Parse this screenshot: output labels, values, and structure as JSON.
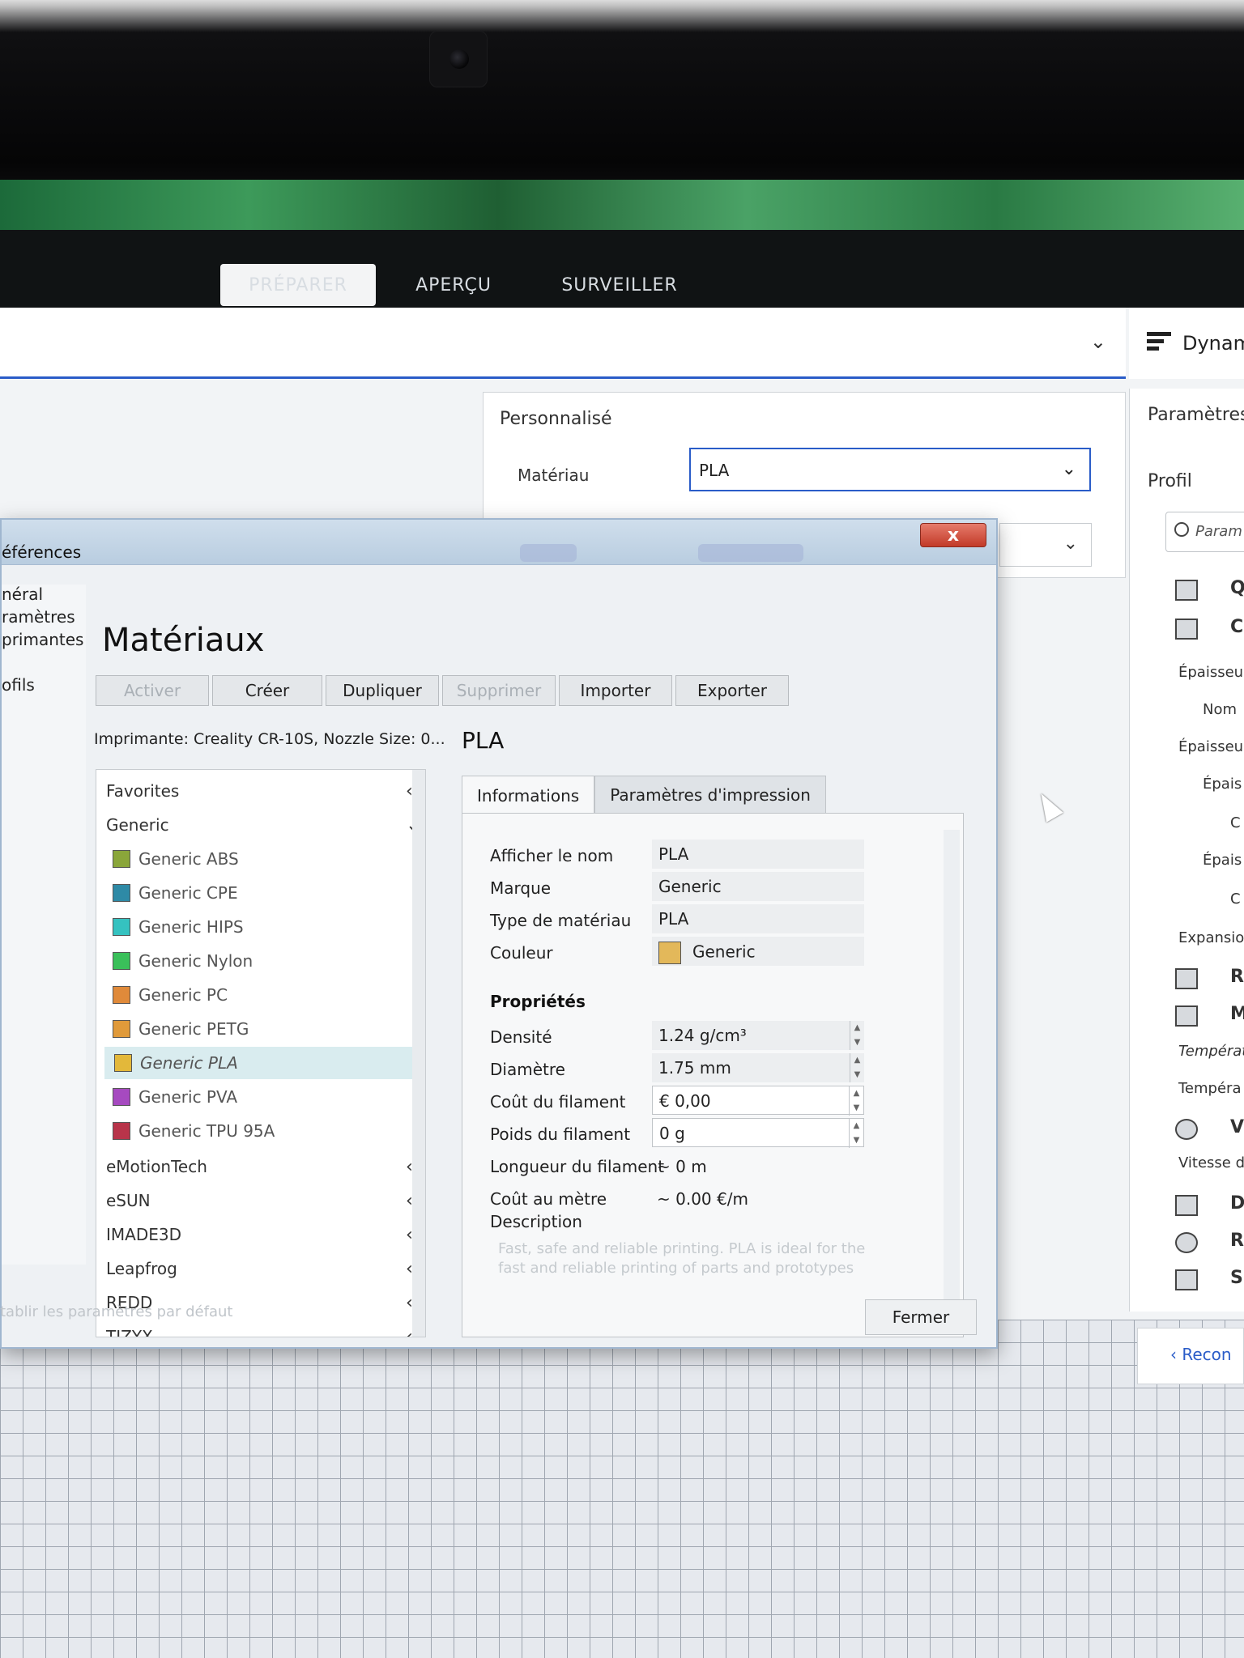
{
  "tabs": {
    "preparer": "PRÉPARER",
    "apercu": "APERÇU",
    "surveiller": "SURVEILLER"
  },
  "right_top": {
    "label": "Dynam"
  },
  "custom_panel": {
    "title": "Personnalisé",
    "material_label": "Matériau",
    "material_value": "PLA"
  },
  "right_panel": {
    "param_title": "Paramètres",
    "profil": "Profil",
    "search_placeholder": "Param",
    "rows": [
      "Q",
      "C",
      "Épaisseu",
      "Nom",
      "Épaisseu",
      "Épais",
      "C",
      "Épais",
      "C",
      "Expansio",
      "R",
      "M",
      "Températ",
      "Tempéra",
      "Vi",
      "Vitesse d",
      "D",
      "R",
      "Su"
    ],
    "recon": "Recon"
  },
  "dialog": {
    "title": "éférences",
    "close_label": "x",
    "nav": [
      "néral",
      "ramètres",
      "primantes",
      "ofils"
    ],
    "heading": "Matériaux",
    "toolbar": {
      "activer": "Activer",
      "creer": "Créer",
      "dupliquer": "Dupliquer",
      "supprimer": "Supprimer",
      "importer": "Importer",
      "exporter": "Exporter"
    },
    "printer": "Imprimante: Creality CR-10S, Nozzle Size: 0...",
    "material_title": "PLA",
    "list": {
      "favorites": "Favorites",
      "generic": "Generic",
      "items": [
        {
          "name": "Generic ABS",
          "color": "#8aa63a"
        },
        {
          "name": "Generic CPE",
          "color": "#2e8aa6"
        },
        {
          "name": "Generic HIPS",
          "color": "#35c2c0"
        },
        {
          "name": "Generic Nylon",
          "color": "#3ac05a"
        },
        {
          "name": "Generic PC",
          "color": "#e08a3a"
        },
        {
          "name": "Generic PETG",
          "color": "#e09a3a"
        },
        {
          "name": "Generic PLA",
          "color": "#e3b83a"
        },
        {
          "name": "Generic PVA",
          "color": "#a64ac0"
        },
        {
          "name": "Generic TPU 95A",
          "color": "#b8344a"
        }
      ],
      "brands": [
        "eMotionTech",
        "eSUN",
        "IMADE3D",
        "Leapfrog",
        "REDD",
        "TIZYX"
      ]
    },
    "tabs": {
      "informations": "Informations",
      "params": "Paramètres d'impression"
    },
    "info": {
      "display_name_label": "Afficher le nom",
      "display_name": "PLA",
      "brand_label": "Marque",
      "brand": "Generic",
      "type_label": "Type de matériau",
      "type": "PLA",
      "color_label": "Couleur",
      "color": "Generic",
      "props_title": "Propriétés",
      "density_label": "Densité",
      "density": "1.24 g/cm³",
      "diameter_label": "Diamètre",
      "diameter": "1.75 mm",
      "cost_label": "Coût du filament",
      "cost": "€ 0,00",
      "weight_label": "Poids du filament",
      "weight": "0 g",
      "length_label": "Longueur du filament",
      "length": "~ 0 m",
      "cost_per_m_label": "Coût au mètre",
      "cost_per_m": "~ 0.00 €/m",
      "desc_label": "Description",
      "desc": "Fast, safe and reliable printing. PLA is ideal for the fast and reliable printing of parts and prototypes"
    },
    "reset": "tablir les paramètres par défaut",
    "close_button": "Fermer"
  }
}
